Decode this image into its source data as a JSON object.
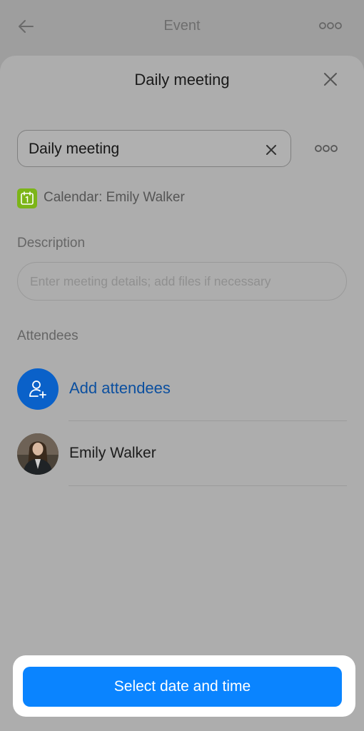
{
  "header": {
    "title": "Event",
    "back_icon": "back-arrow-icon",
    "more_icon": "more-horizontal-icon"
  },
  "sheet": {
    "title": "Daily meeting",
    "close_icon": "close-icon"
  },
  "event_form": {
    "title_value": "Daily meeting",
    "clear_icon": "clear-icon",
    "more_icon": "more-horizontal-icon",
    "calendar_label": "Calendar: Emily Walker",
    "calendar_icon": "calendar-icon",
    "description_label": "Description",
    "description_placeholder": "Enter meeting details; add files if necessary"
  },
  "attendees": {
    "label": "Attendees",
    "add_label": "Add attendees",
    "add_icon": "add-user-icon",
    "people": [
      {
        "name": "Emily Walker"
      }
    ]
  },
  "footer": {
    "button_label": "Select date and time"
  },
  "colors": {
    "accent": "#0a84ff",
    "link": "#0b4f9f",
    "add_avatar": "#0a61c9",
    "calendar_green": "#7cb518",
    "overlay_bg": "#9e9e9e",
    "sheet_bg": "#adadad"
  }
}
